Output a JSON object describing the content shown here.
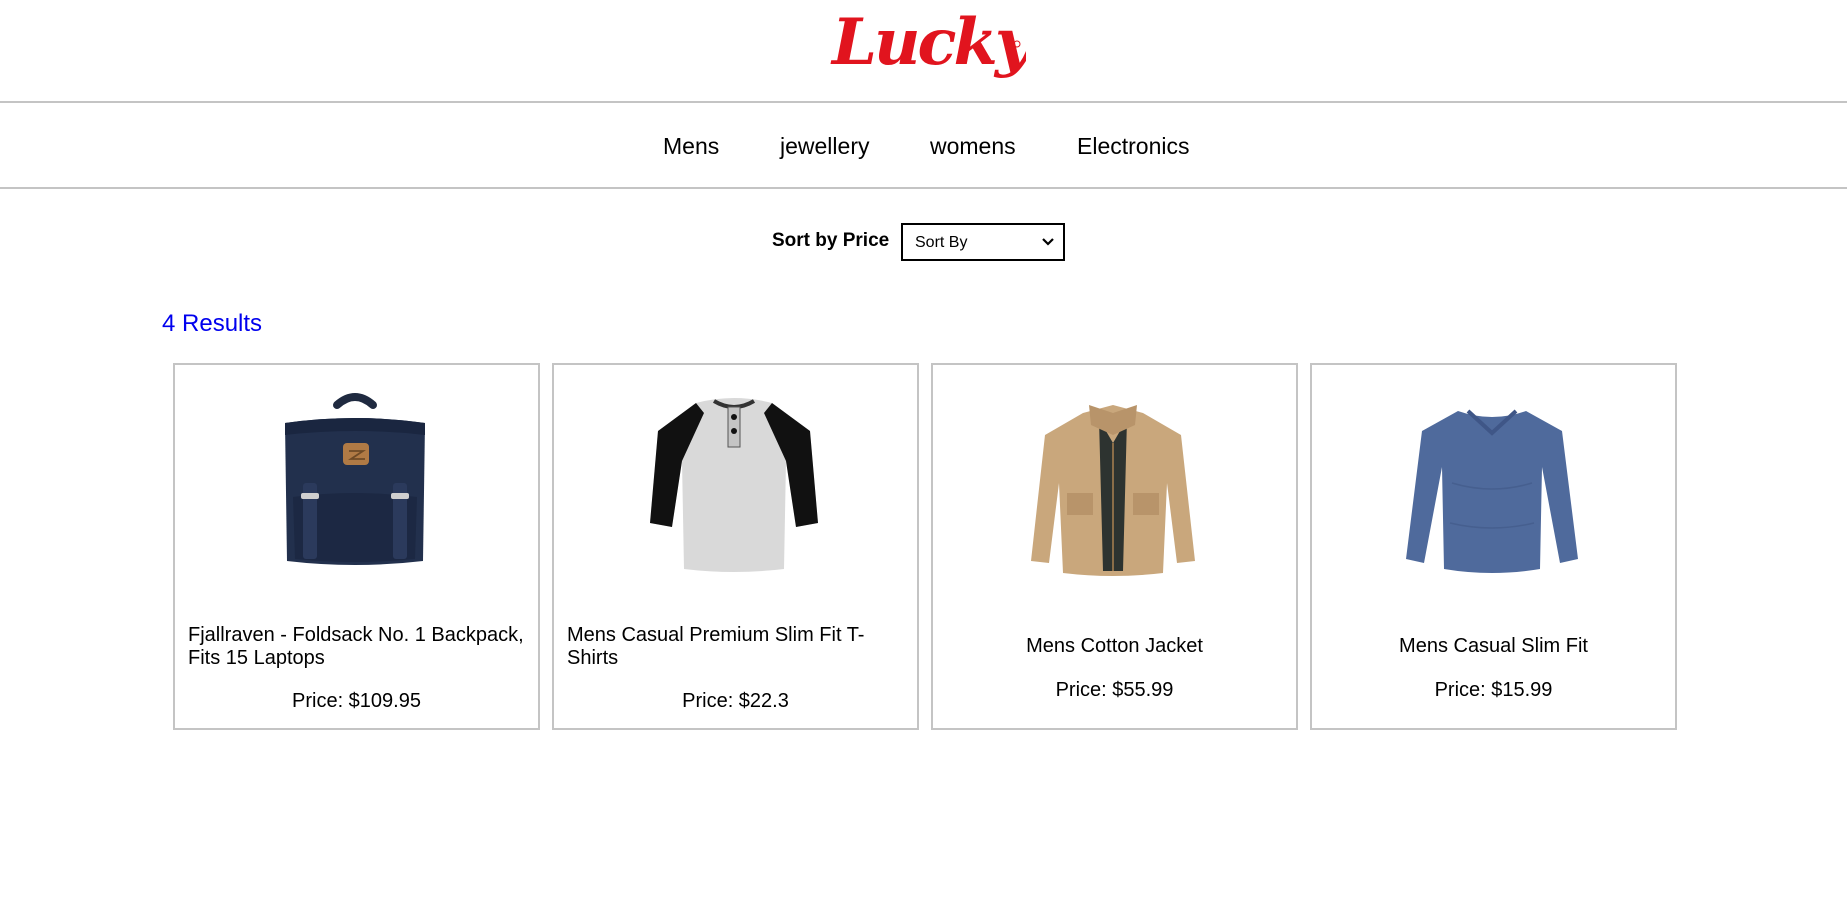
{
  "brand": {
    "logo_text": "Lucky",
    "color": "#e1141e"
  },
  "nav": {
    "items": [
      {
        "label": "Mens"
      },
      {
        "label": "jewellery"
      },
      {
        "label": "womens"
      },
      {
        "label": "Electronics"
      }
    ]
  },
  "sort": {
    "label": "Sort by Price",
    "selected": "Sort By"
  },
  "results": {
    "count_text": "4 Results",
    "link_color": "#0000ee"
  },
  "products": [
    {
      "title": "Fjallraven - Foldsack No. 1 Backpack, Fits 15 Laptops",
      "price": "Price: $109.95",
      "image_icon": "navy-backpack"
    },
    {
      "title": "Mens Casual Premium Slim Fit T-Shirts",
      "price": "Price: $22.3",
      "image_icon": "raglan-henley-shirt"
    },
    {
      "title": "Mens Cotton Jacket",
      "price": "Price: $55.99",
      "image_icon": "khaki-jacket"
    },
    {
      "title": "Mens Casual Slim Fit",
      "price": "Price: $15.99",
      "image_icon": "blue-longsleeve-shirt"
    }
  ]
}
